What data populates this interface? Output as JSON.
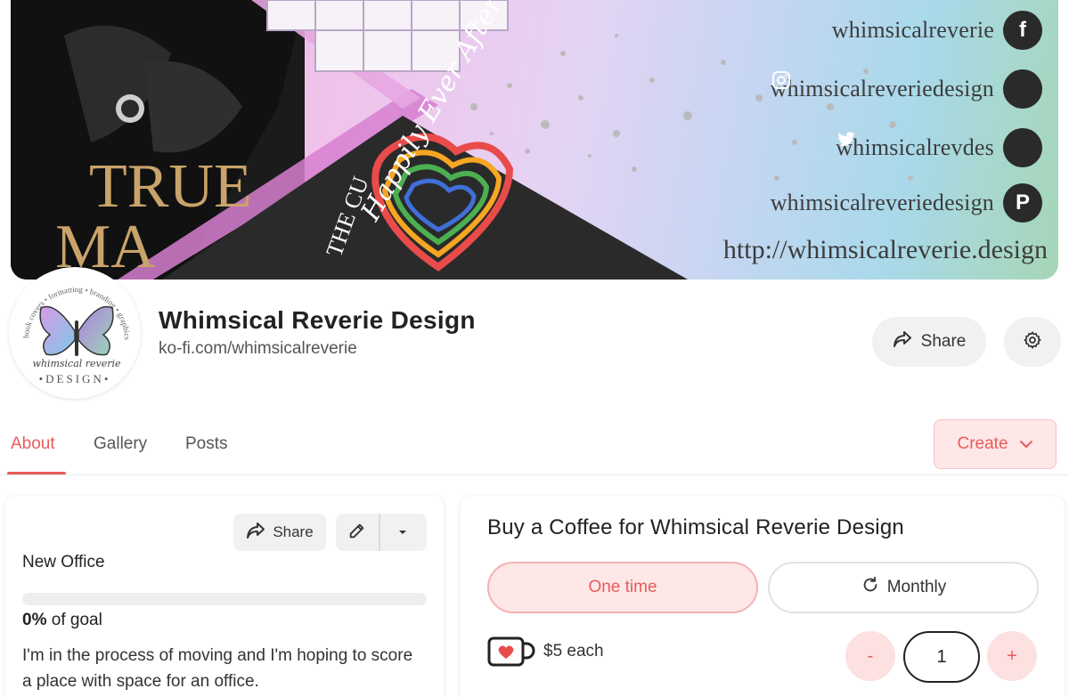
{
  "banner": {
    "book_title_text": "TRUE",
    "book_title_partial": "MA",
    "book_subtitle_text": "THE CU",
    "happily_text": "Happily Ever After",
    "social": [
      {
        "handle": "whimsicalreverie",
        "icon": "facebook-icon",
        "glyph": "f"
      },
      {
        "handle": "whimsicalreveriedesign",
        "icon": "instagram-icon",
        "glyph": "◎"
      },
      {
        "handle": "whimsicalrevdes",
        "icon": "twitter-icon",
        "glyph": "🐦"
      },
      {
        "handle": "whimsicalreveriedesign",
        "icon": "pinterest-icon",
        "glyph": "P"
      }
    ],
    "url": "http://whimsicalreverie.design"
  },
  "avatar": {
    "ring_text": "book covers • formatting • branding • graphics",
    "script_text": "whimsical reverie",
    "design_text": "•DESIGN•"
  },
  "profile": {
    "name": "Whimsical Reverie Design",
    "url": "ko-fi.com/whimsicalreverie",
    "share_label": "Share"
  },
  "tabs": [
    {
      "label": "About",
      "active": true
    },
    {
      "label": "Gallery",
      "active": false
    },
    {
      "label": "Posts",
      "active": false
    }
  ],
  "create_label": "Create",
  "goal": {
    "share_label": "Share",
    "title": "New Office",
    "progress_fraction": 0,
    "percent_value": "0%",
    "percent_suffix": " of goal",
    "description": "I'm in the process of moving and I'm hoping to score a place with space for an office."
  },
  "coffee": {
    "title": "Buy a Coffee for Whimsical Reverie Design",
    "one_time_label": "One time",
    "monthly_label": "Monthly",
    "price_each": "$5 each",
    "quantity": "1",
    "minus_label": "-",
    "plus_label": "+"
  },
  "colors": {
    "accent": "#e95b5b",
    "accent_soft": "#fde7e7",
    "neutral_button": "#f1f1f1"
  }
}
